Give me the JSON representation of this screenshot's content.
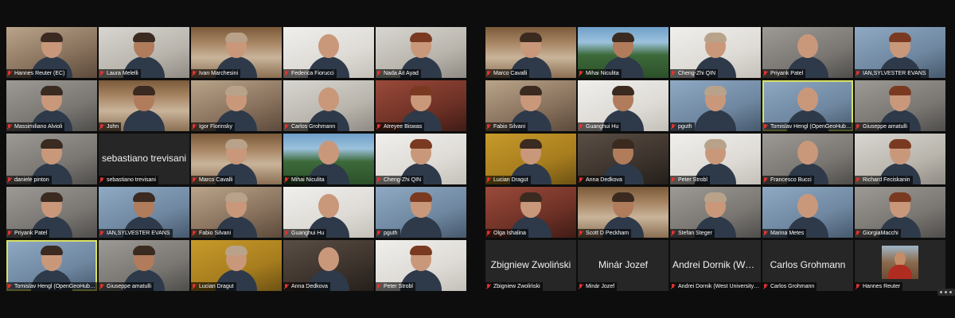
{
  "left_panel": [
    {
      "name": "Hannes Reuter (EC)",
      "bg": "warm"
    },
    {
      "name": "Laura Melelli",
      "bg": "light"
    },
    {
      "name": "Ivan Marchesini",
      "bg": "shelf"
    },
    {
      "name": "Federica Fiorucci",
      "bg": "white"
    },
    {
      "name": "Nada Ait Ayad",
      "bg": "light"
    },
    {
      "name": "Massimiliano Alvioli",
      "bg": "grey"
    },
    {
      "name": "John",
      "bg": "shelf"
    },
    {
      "name": "Igor Florinsky",
      "bg": "warm"
    },
    {
      "name": "Carlos Grohmann",
      "bg": "light"
    },
    {
      "name": "Atreyee Biswas",
      "bg": "red"
    },
    {
      "name": "daniele pinton",
      "bg": "grey"
    },
    {
      "name": "sebastiano trevisani",
      "bg": "name",
      "display": "sebastiano trevisani"
    },
    {
      "name": "Marco Cavalli",
      "bg": "shelf"
    },
    {
      "name": "Mihai Niculita",
      "bg": "green"
    },
    {
      "name": "Cheng-Zhi QIN",
      "bg": "white"
    },
    {
      "name": "Priyank Patel",
      "bg": "grey"
    },
    {
      "name": "IAN,SYLVESTER EVANS",
      "bg": "blue"
    },
    {
      "name": "Fabio Silvani",
      "bg": "warm"
    },
    {
      "name": "Guanghui Hu",
      "bg": "white"
    },
    {
      "name": "pguth",
      "bg": "blue"
    },
    {
      "name": "Tomislav Hengl (OpenGeoHub Foundation)",
      "bg": "blue",
      "active": true
    },
    {
      "name": "Giuseppe amatulli",
      "bg": "grey"
    },
    {
      "name": "Lucian Dragut",
      "bg": "yellow"
    },
    {
      "name": "Anna Dedkova",
      "bg": "dark"
    },
    {
      "name": "Peter Strobl",
      "bg": "white"
    }
  ],
  "right_panel": [
    {
      "name": "Marco Cavalli",
      "bg": "shelf"
    },
    {
      "name": "Mihai Niculita",
      "bg": "green"
    },
    {
      "name": "Cheng-Zhi QIN",
      "bg": "white"
    },
    {
      "name": "Priyank Patel",
      "bg": "grey"
    },
    {
      "name": "IAN,SYLVESTER EVANS",
      "bg": "blue"
    },
    {
      "name": "Fabio Silvani",
      "bg": "warm"
    },
    {
      "name": "Guanghui Hu",
      "bg": "white"
    },
    {
      "name": "pguth",
      "bg": "blue"
    },
    {
      "name": "Tomislav Hengl (OpenGeoHub Foundation)",
      "bg": "blue",
      "active": true
    },
    {
      "name": "Giuseppe amatulli",
      "bg": "grey"
    },
    {
      "name": "Lucian Dragut",
      "bg": "yellow"
    },
    {
      "name": "Anna Dedkova",
      "bg": "dark"
    },
    {
      "name": "Peter Strobl",
      "bg": "white"
    },
    {
      "name": "Francesco Bucci",
      "bg": "grey"
    },
    {
      "name": "Richard Feciskanin",
      "bg": "light"
    },
    {
      "name": "Olga Ishalina",
      "bg": "red"
    },
    {
      "name": "Scott D Peckham",
      "bg": "shelf"
    },
    {
      "name": "Stefan Steger",
      "bg": "grey"
    },
    {
      "name": "Marina Metes",
      "bg": "blue"
    },
    {
      "name": "GiorgiaMacchi",
      "bg": "grey"
    },
    {
      "name": "Zbigniew Zwoliński",
      "bg": "name",
      "display": "Zbigniew Zwoliński"
    },
    {
      "name": "Minár Jozef",
      "bg": "name",
      "display": "Minár Jozef"
    },
    {
      "name": "Andrei Dornik (West University of Timisoara)",
      "bg": "name",
      "display": "Andrei Dornik (West U..."
    },
    {
      "name": "Carlos Grohmann",
      "bg": "name",
      "display": "Carlos Grohmann"
    },
    {
      "name": "Hannes Reuter",
      "bg": "name",
      "avatar": true
    }
  ],
  "mic_icon": "muted-microphone-icon",
  "active_border_color": "#d8e060",
  "mic_color": "#e5322d"
}
